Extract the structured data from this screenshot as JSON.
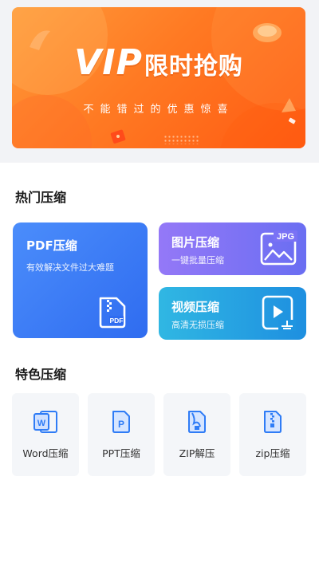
{
  "banner": {
    "title_en": "VIP",
    "title_cn": "限时抢购",
    "subtitle": "不能错过的优惠惊喜"
  },
  "hot_section": {
    "title": "热门压缩",
    "cards": [
      {
        "title": "PDF压缩",
        "subtitle": "有效解决文件过大难题",
        "icon": "pdf-file-icon"
      },
      {
        "title": "图片压缩",
        "subtitle": "一键批量压缩",
        "icon": "jpg-image-icon"
      },
      {
        "title": "视频压缩",
        "subtitle": "高清无损压缩",
        "icon": "video-play-icon"
      }
    ]
  },
  "special_section": {
    "title": "特色压缩",
    "tools": [
      {
        "label": "Word压缩",
        "icon": "word-file-icon"
      },
      {
        "label": "PPT压缩",
        "icon": "ppt-file-icon"
      },
      {
        "label": "ZIP解压",
        "icon": "zip-extract-icon"
      },
      {
        "label": "zip压缩",
        "icon": "zip-archive-icon"
      }
    ]
  },
  "colors": {
    "banner_orange": "#ff7a23",
    "pdf_card_blue": "#2f6cf0",
    "image_card_purple": "#7a72f5",
    "video_card_cyan": "#1e9be2",
    "tool_icon_blue": "#2f7cf6"
  }
}
